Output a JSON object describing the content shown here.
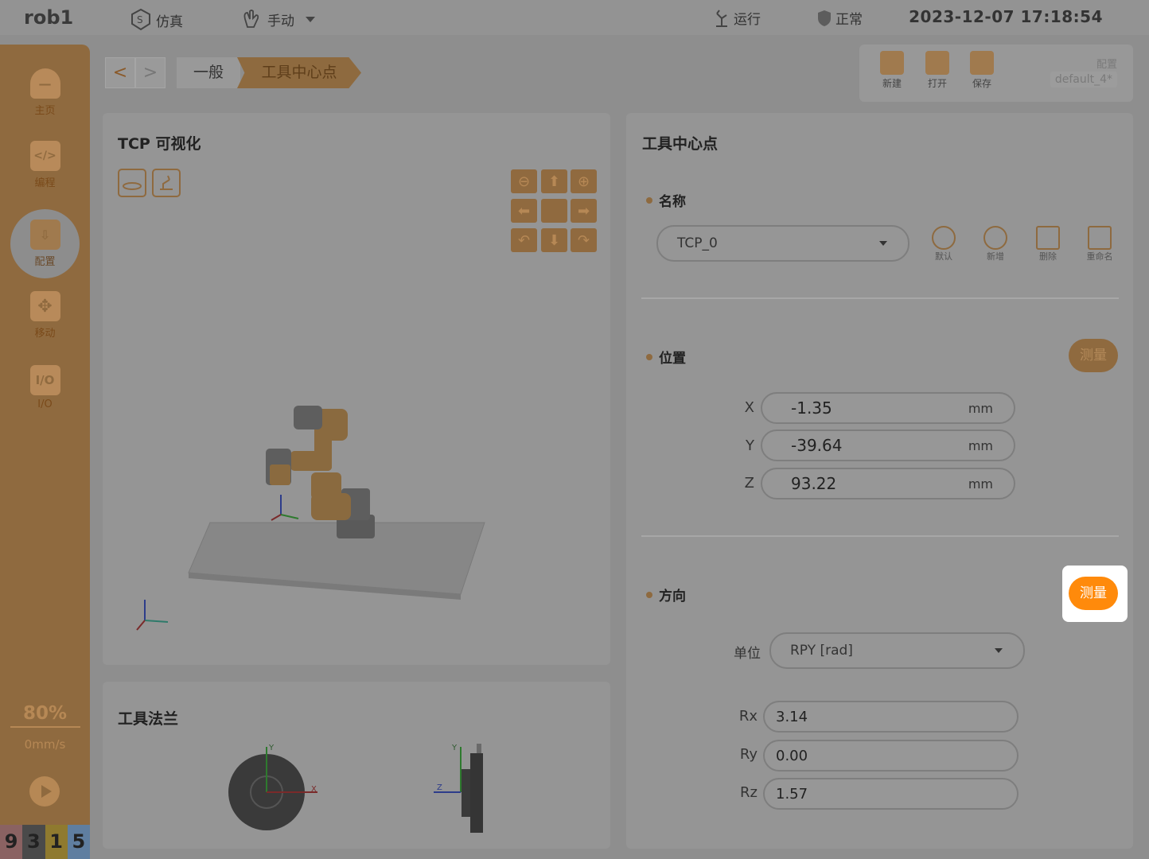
{
  "topbar": {
    "robot": "rob1",
    "sim_label": "仿真",
    "mode_label": "手动",
    "run_label": "运行",
    "status_label": "正常",
    "datetime": "2023-12-07 17:18:54"
  },
  "sidebar": {
    "items": [
      {
        "label": "主页",
        "icon": "home-icon"
      },
      {
        "label": "编程",
        "icon": "code-icon"
      },
      {
        "label": "配置",
        "icon": "config-icon"
      },
      {
        "label": "移动",
        "icon": "move-icon"
      },
      {
        "label": "I/O",
        "icon": "io-icon"
      }
    ],
    "io_glyph": "I/O",
    "code_glyph": "</>",
    "speed_pct": "80%",
    "speed_mms": "0mm/s",
    "digits": [
      "9",
      "3",
      "1",
      "5"
    ],
    "digit_colors": [
      "#8a6262",
      "#4a4a4a",
      "#8f7a2f",
      "#5f7ea0"
    ]
  },
  "breadcrumb": {
    "back": "<",
    "forward": ">",
    "general": "一般",
    "current": "工具中心点"
  },
  "file": {
    "new_label": "新建",
    "open_label": "打开",
    "save_label": "保存",
    "config_label": "配置",
    "config_name": "default_4*"
  },
  "tcp_vis": {
    "title": "TCP 可视化"
  },
  "flange": {
    "title": "工具法兰",
    "axis_x": "X",
    "axis_y": "Y",
    "axis_z": "Z"
  },
  "tcp": {
    "title": "工具中心点",
    "name_section": "名称",
    "selected_tcp": "TCP_0",
    "actions": {
      "default": "默认",
      "add": "新增",
      "delete": "删除",
      "rename": "重命名"
    },
    "position_section": "位置",
    "measure": "测量",
    "x_label": "X",
    "x": "-1.35",
    "y_label": "Y",
    "y": "-39.64",
    "z_label": "Z",
    "z": "93.22",
    "unit_mm": "mm",
    "orientation_section": "方向",
    "unit_label": "单位",
    "unit_value": "RPY [rad]",
    "rx_label": "Rx",
    "rx": "3.14",
    "ry_label": "Ry",
    "ry": "0.00",
    "rz_label": "Rz",
    "rz": "1.57"
  },
  "colors": {
    "accent": "#ff8a0b",
    "dim_accent": "#8f6a3f"
  }
}
